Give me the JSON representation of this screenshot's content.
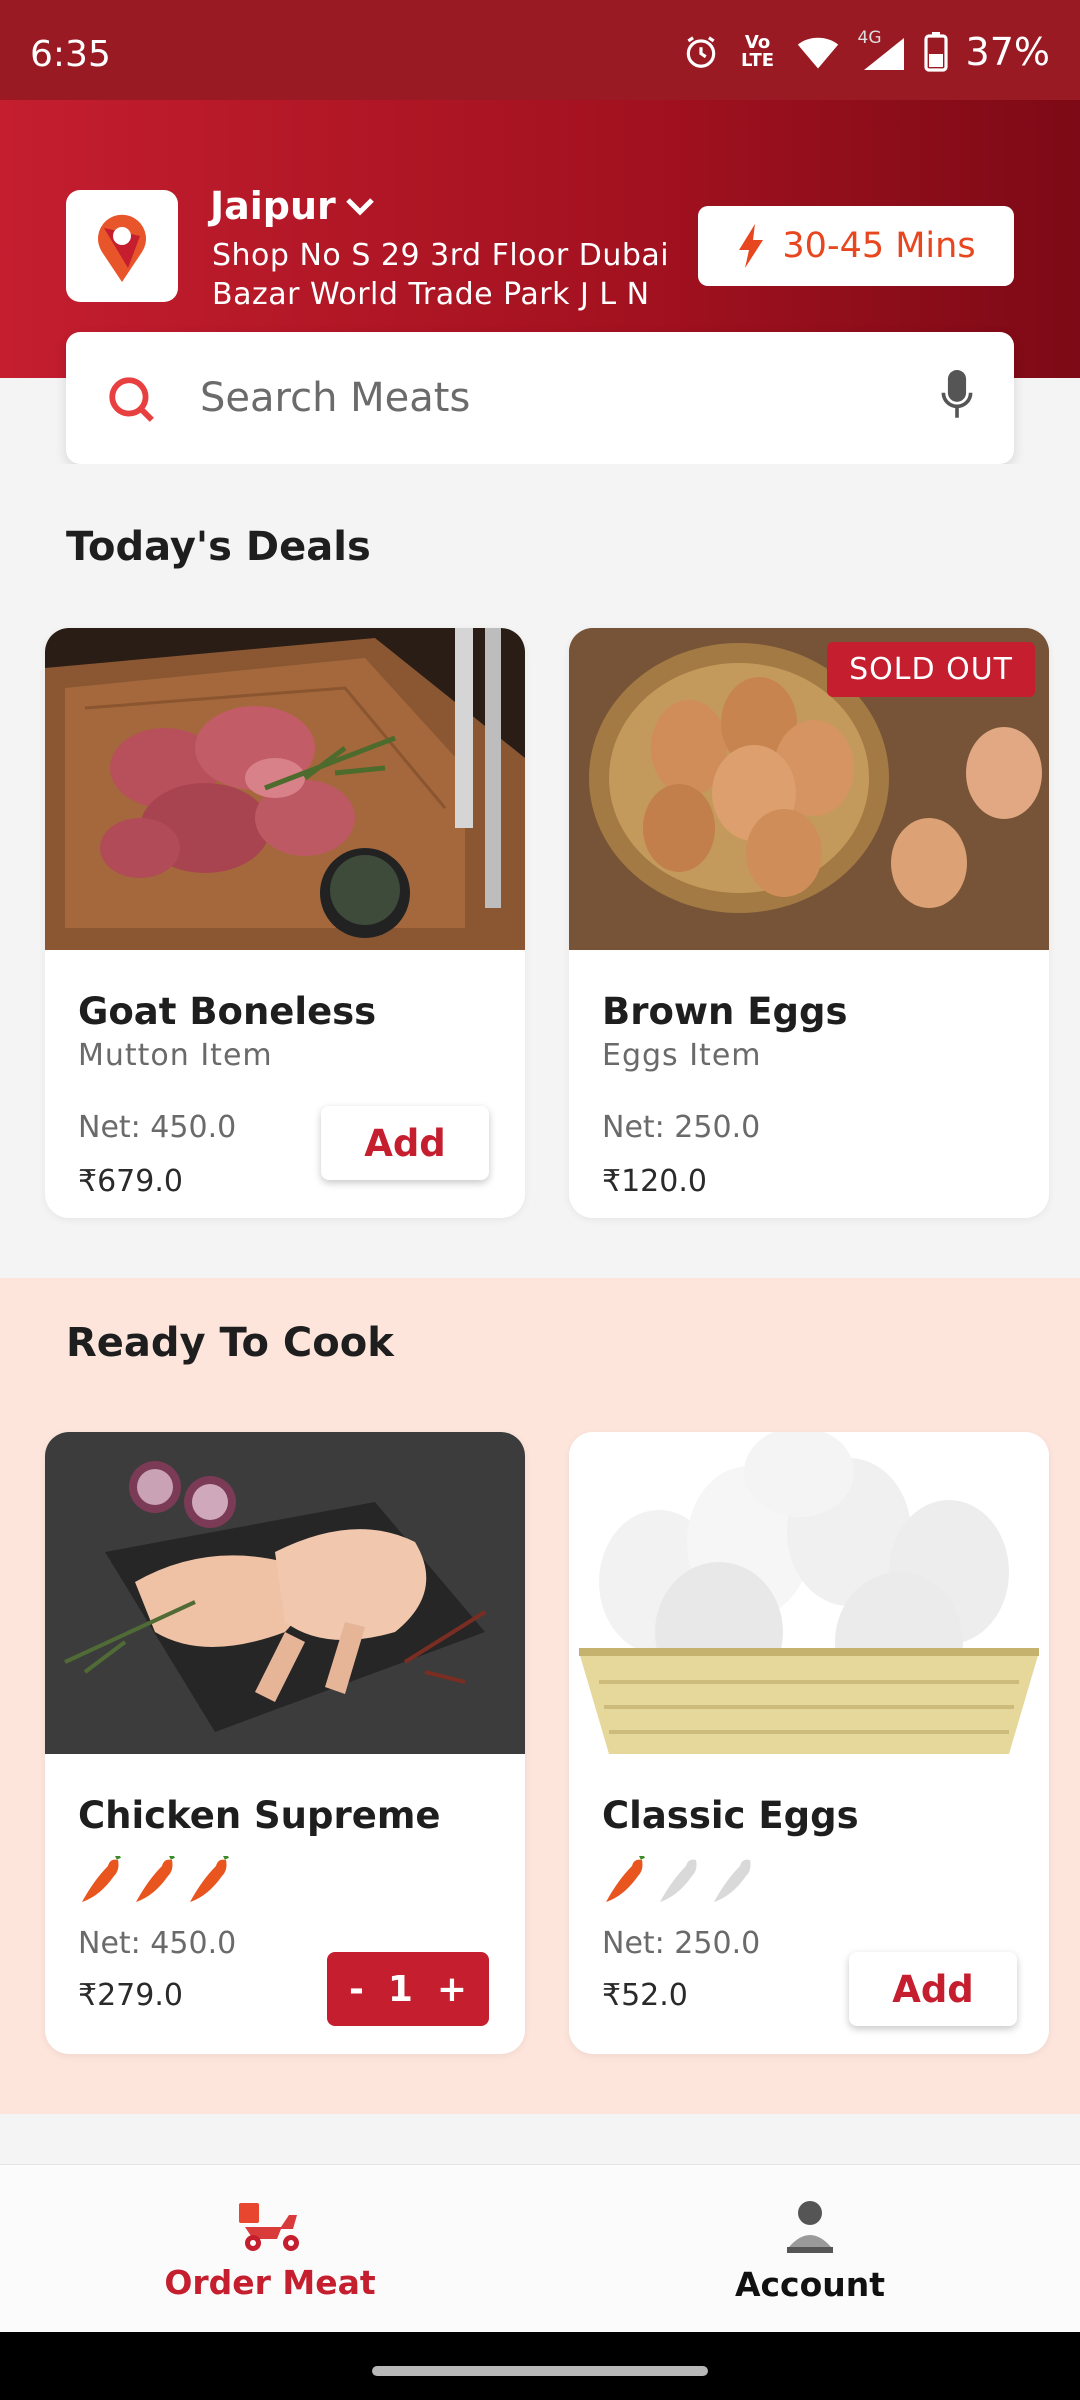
{
  "status_bar": {
    "time": "6:35",
    "network": "4G",
    "lte": "Vo LTE",
    "battery": "37%"
  },
  "header": {
    "city": "Jaipur",
    "address": "Shop No S 29 3rd Floor Dubai Bazar World Trade Park J L N",
    "eta": "30-45 Mins"
  },
  "search": {
    "placeholder": "Search Meats"
  },
  "sections": {
    "deals": {
      "title": "Today's Deals",
      "items": [
        {
          "name": "Goat Boneless",
          "category": "Mutton Item",
          "net": "Net: 450.0",
          "price": "₹679.0",
          "action": "Add"
        },
        {
          "name": "Brown Eggs",
          "category": "Eggs Item",
          "net": "Net: 250.0",
          "price": "₹120.0",
          "badge": "SOLD OUT"
        }
      ]
    },
    "ready": {
      "title": "Ready To Cook",
      "items": [
        {
          "name": "Chicken Supreme",
          "spice_level": 3,
          "net": "Net: 450.0",
          "price": "₹279.0",
          "qty": "1",
          "minus": "-",
          "plus": "+"
        },
        {
          "name": "Classic Eggs",
          "spice_level": 1,
          "net": "Net: 250.0",
          "price": "₹52.0",
          "action": "Add"
        }
      ]
    }
  },
  "nav": {
    "items": [
      {
        "label": "Order Meat",
        "icon": "scooter-icon",
        "active": true
      },
      {
        "label": "Account",
        "icon": "person-icon",
        "active": false
      }
    ]
  },
  "colors": {
    "brand": "#c41e2f",
    "accent": "#e8461f",
    "cook_bg": "#fde5dc"
  }
}
